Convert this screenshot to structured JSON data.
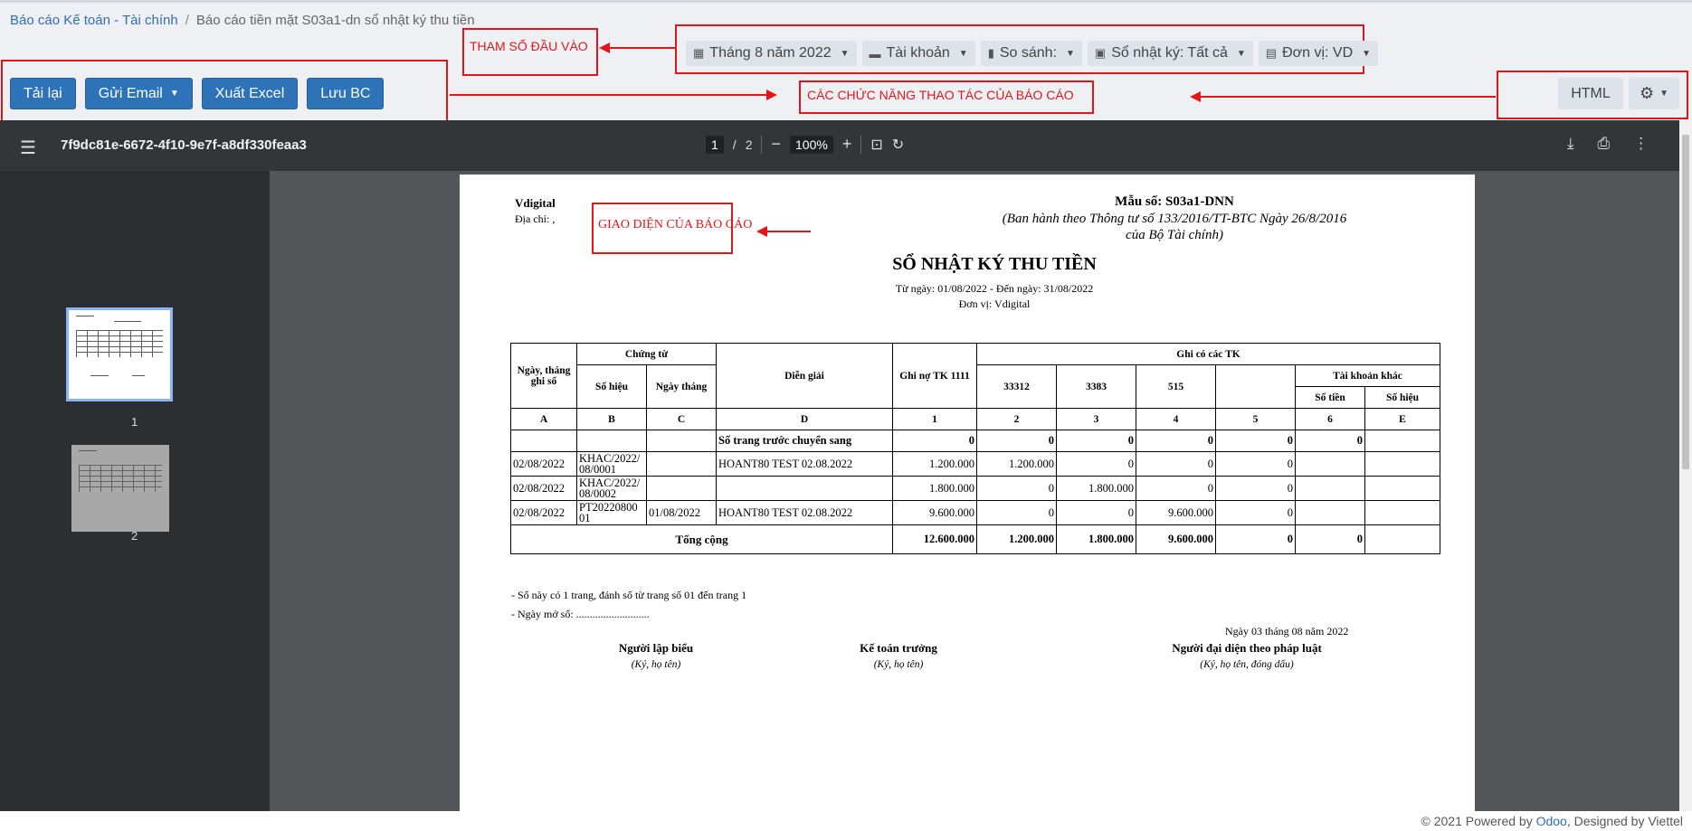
{
  "breadcrumb": {
    "parent": "Báo cáo Kế toán - Tài chính",
    "separator": "/",
    "current": "Báo cáo tiền mặt S03a1-dn sổ nhật ký thu tiền"
  },
  "filters": [
    {
      "icon": "calendar-icon",
      "label": "Tháng 8 năm 2022"
    },
    {
      "icon": "folder-icon",
      "label": "Tài khoản"
    },
    {
      "icon": "bar-chart-icon",
      "label": "So sánh:"
    },
    {
      "icon": "book-icon",
      "label": "Sổ nhật ký: Tất cả"
    },
    {
      "icon": "building-icon",
      "label": "Đơn vị: VD"
    }
  ],
  "actions": {
    "reload": "Tải lại",
    "send_email": "Gửi Email",
    "export_excel": "Xuất Excel",
    "save_report": "Lưu BC"
  },
  "right_buttons": {
    "html": "HTML"
  },
  "annotations": {
    "params": "THAM SỐ ĐẦU VÀO",
    "functions": "CÁC CHỨC NĂNG THAO TÁC CỦA BÁO CÁO",
    "interface": "GIAO DIỆN CỦA BÁO CÁO"
  },
  "viewer": {
    "doc_id": "7f9dc81e-6672-4f10-9e7f-a8df330feaa3",
    "page_current": "1",
    "page_sep": "/",
    "page_total": "2",
    "zoom": "100%",
    "thumbs": [
      "1",
      "2"
    ]
  },
  "report": {
    "company": "Vdigital",
    "address": "Địa chỉ: ,",
    "form_no": "Mẫu số: S03a1-DNN",
    "form_note_1": "(Ban hành theo Thông tư số 133/2016/TT-BTC Ngày 26/8/2016",
    "form_note_2": "của Bộ Tài chính)",
    "title": "SỔ NHẬT KÝ THU TIỀN",
    "period": "Từ ngày: 01/08/2022 - Đến ngày: 31/08/2022",
    "unit": "Đơn vị: Vdigital",
    "headers": {
      "date": "Ngày, tháng ghi sổ",
      "voucher": "Chứng từ",
      "voucher_no": "Số hiệu",
      "voucher_date": "Ngày tháng",
      "desc": "Diễn giải",
      "debit": "Ghi nợ TK 1111",
      "credit_group": "Ghi có các TK",
      "acc1": "33312",
      "acc2": "3383",
      "acc3": "515",
      "acc4": "",
      "other": "Tài khoản khác",
      "other_amount": "Số tiền",
      "other_code": "Số hiệu"
    },
    "codes": [
      "A",
      "B",
      "C",
      "D",
      "1",
      "2",
      "3",
      "4",
      "5",
      "6",
      "E"
    ],
    "carry_row": {
      "label": "Số trang trước chuyển sang",
      "values": [
        "0",
        "0",
        "0",
        "0",
        "0",
        "0"
      ]
    },
    "rows": [
      {
        "date": "02/08/2022",
        "no": "KHAC/2022/ 08/0001",
        "vdate": "",
        "desc": "HOANT80 TEST 02.08.2022",
        "debit": "1.200.000",
        "a1": "1.200.000",
        "a2": "0",
        "a3": "0",
        "a4": "0",
        "oa": "",
        "oc": ""
      },
      {
        "date": "02/08/2022",
        "no": "KHAC/2022/ 08/0002",
        "vdate": "",
        "desc": "",
        "debit": "1.800.000",
        "a1": "0",
        "a2": "1.800.000",
        "a3": "0",
        "a4": "0",
        "oa": "",
        "oc": ""
      },
      {
        "date": "02/08/2022",
        "no": "PT20220800 01",
        "vdate": "01/08/2022",
        "desc": "HOANT80 TEST 02.08.2022",
        "debit": "9.600.000",
        "a1": "0",
        "a2": "0",
        "a3": "9.600.000",
        "a4": "0",
        "oa": "",
        "oc": ""
      }
    ],
    "total": {
      "label": "Tổng cộng",
      "debit": "12.600.000",
      "a1": "1.200.000",
      "a2": "1.800.000",
      "a3": "9.600.000",
      "a4": "0",
      "oa": "0"
    },
    "note1": "- Sổ này có 1 trang, đánh số từ trang số 01 đến trang 1",
    "note2": "- Ngày mở sổ: ...........................",
    "sign_date": "Ngày 03 tháng 08 năm 2022",
    "signers": [
      {
        "title": "Người lập biểu",
        "sub": "(Ký, họ tên)"
      },
      {
        "title": "Kế toán trưởng",
        "sub": "(Ký, họ tên)"
      },
      {
        "title": "Người đại diện theo pháp luật",
        "sub": "(Ký, họ tên, đóng dấu)"
      }
    ]
  },
  "footer": {
    "prefix": "© 2021 Powered by ",
    "odoo": "Odoo",
    "suffix": ", Designed by Viettel"
  },
  "colors": {
    "primary": "#2e73b8",
    "annotation": "#e0161b",
    "viewer_toolbar": "#323639"
  }
}
